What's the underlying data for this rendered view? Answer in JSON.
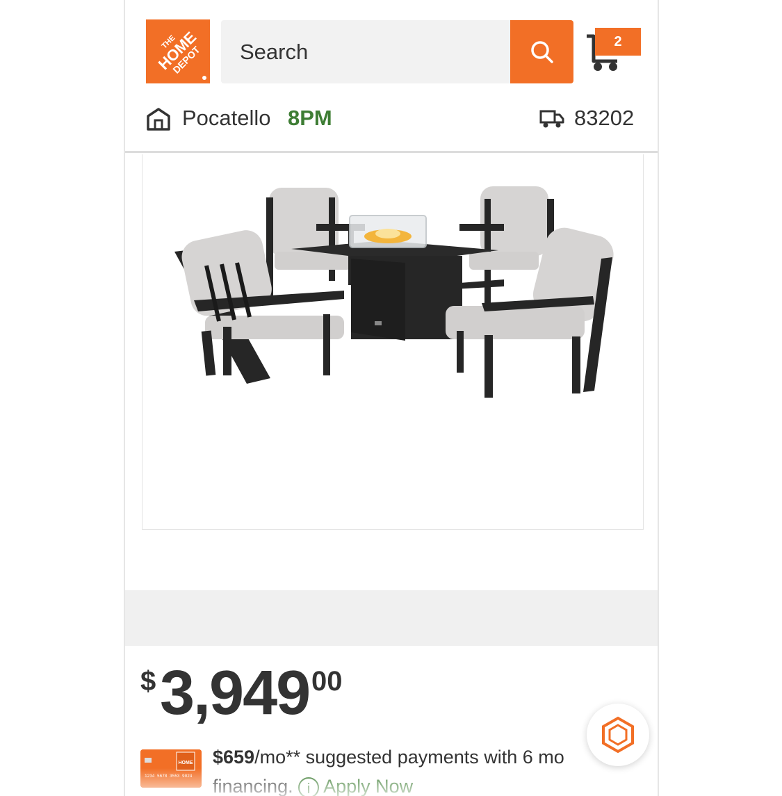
{
  "header": {
    "logo_text": "THE HOME DEPOT",
    "search_placeholder": "Search",
    "cart_count": "2",
    "store_name": "Pocatello",
    "store_hours": "8PM",
    "zip_code": "83202"
  },
  "product": {
    "image_alt": "Black patio conversation set with four cushioned chairs around a square fire pit table"
  },
  "pricing": {
    "currency": "$",
    "whole": "3,949",
    "cents": "00",
    "financing_amount": "$659",
    "financing_text": "/mo** suggested payments with 6 mo",
    "financing_text2": "financing.",
    "apply_label": "Apply Now",
    "card_number_text": "1234 5678 3553 9024"
  },
  "colors": {
    "brand_orange": "#f26f26",
    "store_green": "#3e7d34"
  },
  "icons": [
    "store-icon",
    "truck-icon",
    "search-icon",
    "cart-icon",
    "info-icon",
    "chat-icon"
  ]
}
